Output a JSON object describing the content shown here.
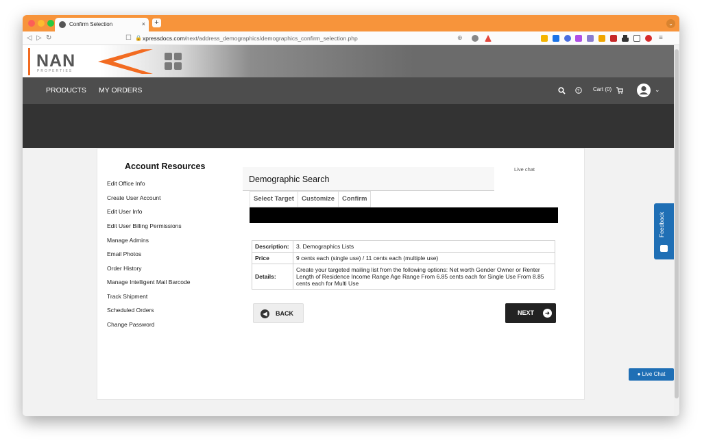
{
  "browser": {
    "tab_title": "Confirm Selection",
    "tab_close": "×",
    "new_tab": "+",
    "url_domain": "xpressdocs.com",
    "url_path": "/next/address_demographics/demographics_confirm_selection.php"
  },
  "site": {
    "logo_text": "NAN",
    "logo_sub": "PROPERTIES",
    "nav": {
      "products": "PRODUCTS",
      "my_orders": "MY ORDERS",
      "cart": "Cart (0)"
    }
  },
  "sidebar": {
    "title": "Account Resources",
    "items": [
      "Edit Office Info",
      "Create User Account",
      "Edit User Info",
      "Edit User Billing Permissions",
      "Manage Admins",
      "Email Photos",
      "Order History",
      "Manage Intelligent Mail Barcode",
      "Track Shipment",
      "Scheduled Orders",
      "Change Password"
    ]
  },
  "main": {
    "live_chat_link": "Live chat",
    "section_title": "Demographic Search",
    "steps": [
      "Select Target",
      "Customize",
      "Confirm"
    ],
    "details": {
      "description_label": "Description:",
      "description_value": "3. Demographics Lists",
      "price_label": "Price",
      "price_value": "9 cents each (single use) / 11 cents each (multiple use)",
      "details_label": "Details:",
      "details_value": "Create your targeted mailing list from the following options: Net worth Gender Owner or Renter Length of Residence Income Range Age Range From 6.85 cents each for Single Use From 8.85 cents each for Multi Use"
    },
    "back_label": "BACK",
    "next_label": "NEXT"
  },
  "widgets": {
    "feedback_label": "Feedback",
    "live_chat_button": "Live Chat"
  },
  "colors": {
    "tabbar": "#f7943b",
    "nav": "#4d4d4d",
    "hero": "#333333",
    "accent_blue": "#1f6fb5",
    "logo_orange": "#f26b21"
  }
}
